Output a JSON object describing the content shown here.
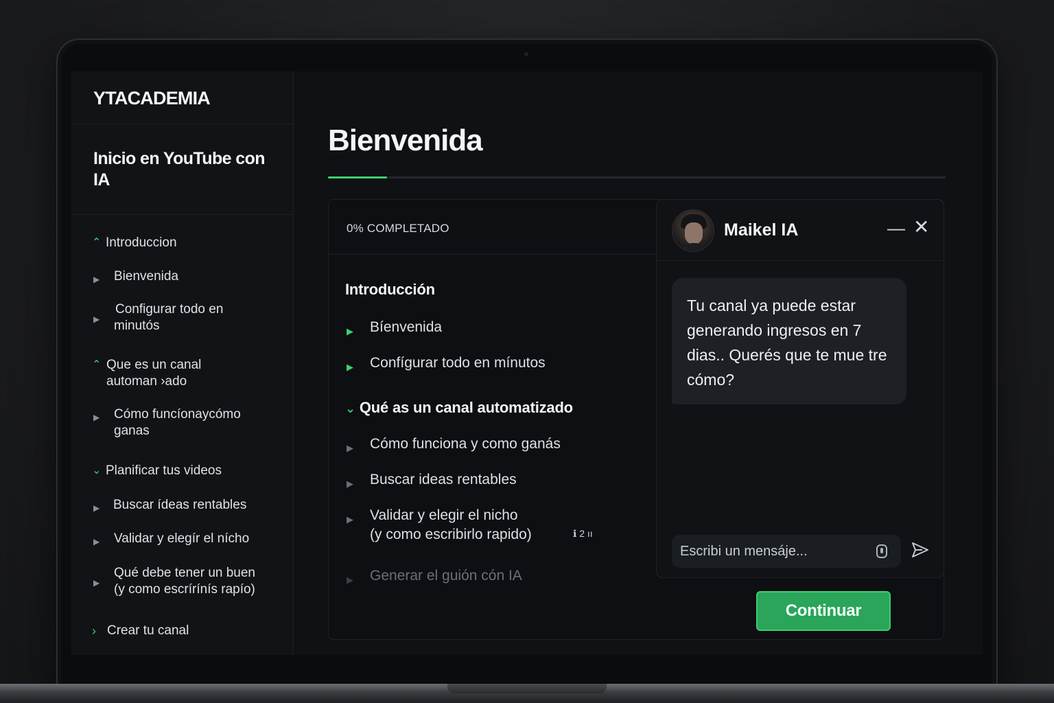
{
  "app": {
    "brand": "YTACADEMIA"
  },
  "sidebar": {
    "course_title": "Inicio en YouTube con IA",
    "items": [
      {
        "type": "section",
        "expanded": true,
        "label": "Introduccion"
      },
      {
        "type": "lesson",
        "label": "Bienvenida"
      },
      {
        "type": "lesson",
        "label_lines": [
          "Configurar  todo en",
          "minutós"
        ]
      },
      {
        "type": "section",
        "expanded": true,
        "label_lines": [
          "Que es un canal",
          "automan ›ado"
        ]
      },
      {
        "type": "lesson",
        "label_lines": [
          "Cómo funcíonaycómo",
          "ganas"
        ]
      },
      {
        "type": "section",
        "expanded": true,
        "label": "Planificar tus videos"
      },
      {
        "type": "lesson",
        "label": "Buscar ídeas rentables"
      },
      {
        "type": "lesson",
        "label": "Validar y elegír el níсho"
      },
      {
        "type": "lesson",
        "label_lines": [
          "Qué debe tener un buen",
          "(y como escrírínís rapío)"
        ]
      },
      {
        "type": "section",
        "expanded": false,
        "label": "Crear tu canal"
      }
    ]
  },
  "main": {
    "title": "Bienvenida",
    "progress_fraction": 0.095,
    "card": {
      "completed_label": "0% COMPLETADO",
      "sections": [
        {
          "title": "Introducción",
          "lessons": [
            "Bíenvenida",
            "Confígurar todo en mínutos"
          ]
        },
        {
          "title": "Qué as un canal automatizado",
          "lessons": [
            "Cómo funciona y como ganás",
            "Buscar ideas rentables",
            [
              "Validar y elegir el nicho",
              "(y como escribirlo rapido)"
            ],
            "Generar el guión cón IA"
          ],
          "badge": "ℹ 2 ıı"
        }
      ]
    },
    "continue_label": "Continuar"
  },
  "chat": {
    "name": "Maikel IA",
    "minimize_glyph": "—",
    "close_glyph": "✕",
    "message": "Tu canal ya puede estar generando ingresos en 7 dias.. Querés que te mue tre cómo?",
    "input_placeholder": "Escribi un mensáje...",
    "icons": [
      "minimize-icon",
      "close-icon",
      "microphone-icon",
      "send-icon"
    ]
  },
  "colors": {
    "accent": "#3ecf6e",
    "button": "#2aa55a",
    "background": "#0f1114"
  }
}
